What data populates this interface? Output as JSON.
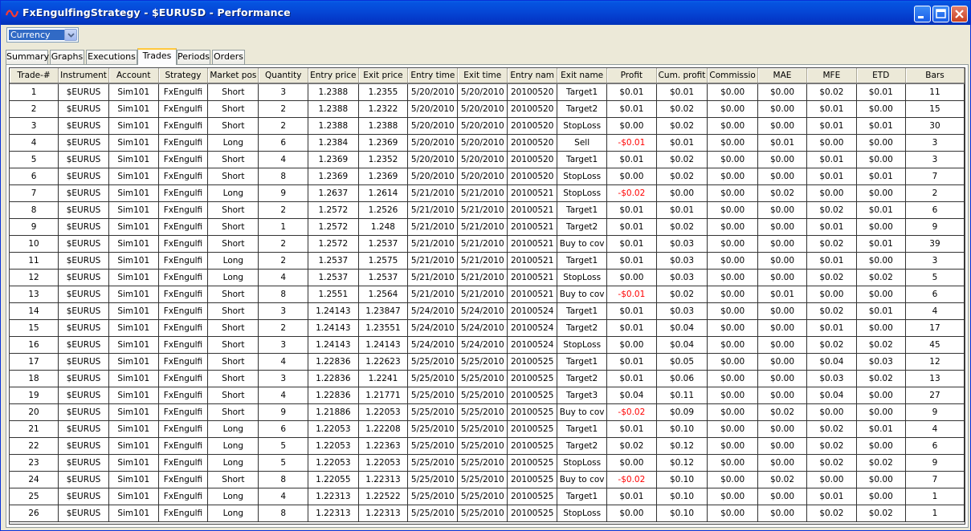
{
  "window": {
    "title": "FxEngulfingStrategy - $EURUSD - Performance"
  },
  "toolbar": {
    "currency_value": "Currency"
  },
  "tabs": [
    {
      "label": "Summary"
    },
    {
      "label": "Graphs"
    },
    {
      "label": "Executions"
    },
    {
      "label": "Trades"
    },
    {
      "label": "Periods"
    },
    {
      "label": "Orders"
    }
  ],
  "active_tab": "Trades",
  "colors": {
    "negative_profit": "#ff0000",
    "selection": "#316ac5"
  },
  "table": {
    "columns": [
      "Trade-#",
      "Instrument",
      "Account",
      "Strategy",
      "Market pos",
      "Quantity",
      "Entry price",
      "Exit price",
      "Entry time",
      "Exit time",
      "Entry nam",
      "Exit name",
      "Profit",
      "Cum. profit",
      "Commissio",
      "MAE",
      "MFE",
      "ETD",
      "Bars"
    ],
    "rows": [
      [
        "1",
        "$EURUS",
        "Sim101",
        "FxEngulfi",
        "Short",
        "3",
        "1.2388",
        "1.2355",
        "5/20/2010",
        "5/20/2010",
        "20100520",
        "Target1",
        "$0.01",
        "$0.01",
        "$0.00",
        "$0.00",
        "$0.02",
        "$0.01",
        "11"
      ],
      [
        "2",
        "$EURUS",
        "Sim101",
        "FxEngulfi",
        "Short",
        "2",
        "1.2388",
        "1.2322",
        "5/20/2010",
        "5/20/2010",
        "20100520",
        "Target2",
        "$0.01",
        "$0.02",
        "$0.00",
        "$0.00",
        "$0.01",
        "$0.00",
        "15"
      ],
      [
        "3",
        "$EURUS",
        "Sim101",
        "FxEngulfi",
        "Short",
        "2",
        "1.2388",
        "1.2388",
        "5/20/2010",
        "5/20/2010",
        "20100520",
        "StopLoss",
        "$0.00",
        "$0.02",
        "$0.00",
        "$0.00",
        "$0.01",
        "$0.01",
        "30"
      ],
      [
        "4",
        "$EURUS",
        "Sim101",
        "FxEngulfi",
        "Long",
        "6",
        "1.2384",
        "1.2369",
        "5/20/2010",
        "5/20/2010",
        "20100520",
        "Sell",
        "-$0.01",
        "$0.01",
        "$0.00",
        "$0.01",
        "$0.00",
        "$0.00",
        "3"
      ],
      [
        "5",
        "$EURUS",
        "Sim101",
        "FxEngulfi",
        "Short",
        "4",
        "1.2369",
        "1.2352",
        "5/20/2010",
        "5/20/2010",
        "20100520",
        "Target1",
        "$0.01",
        "$0.02",
        "$0.00",
        "$0.00",
        "$0.01",
        "$0.00",
        "3"
      ],
      [
        "6",
        "$EURUS",
        "Sim101",
        "FxEngulfi",
        "Short",
        "8",
        "1.2369",
        "1.2369",
        "5/20/2010",
        "5/20/2010",
        "20100520",
        "StopLoss",
        "$0.00",
        "$0.02",
        "$0.00",
        "$0.00",
        "$0.01",
        "$0.01",
        "7"
      ],
      [
        "7",
        "$EURUS",
        "Sim101",
        "FxEngulfi",
        "Long",
        "9",
        "1.2637",
        "1.2614",
        "5/21/2010",
        "5/21/2010",
        "20100521",
        "StopLoss",
        "-$0.02",
        "$0.00",
        "$0.00",
        "$0.02",
        "$0.00",
        "$0.00",
        "2"
      ],
      [
        "8",
        "$EURUS",
        "Sim101",
        "FxEngulfi",
        "Short",
        "2",
        "1.2572",
        "1.2526",
        "5/21/2010",
        "5/21/2010",
        "20100521",
        "Target1",
        "$0.01",
        "$0.01",
        "$0.00",
        "$0.00",
        "$0.02",
        "$0.01",
        "6"
      ],
      [
        "9",
        "$EURUS",
        "Sim101",
        "FxEngulfi",
        "Short",
        "1",
        "1.2572",
        "1.248",
        "5/21/2010",
        "5/21/2010",
        "20100521",
        "Target2",
        "$0.01",
        "$0.02",
        "$0.00",
        "$0.00",
        "$0.01",
        "$0.00",
        "9"
      ],
      [
        "10",
        "$EURUS",
        "Sim101",
        "FxEngulfi",
        "Short",
        "2",
        "1.2572",
        "1.2537",
        "5/21/2010",
        "5/21/2010",
        "20100521",
        "Buy to cov",
        "$0.01",
        "$0.03",
        "$0.00",
        "$0.00",
        "$0.02",
        "$0.01",
        "39"
      ],
      [
        "11",
        "$EURUS",
        "Sim101",
        "FxEngulfi",
        "Long",
        "2",
        "1.2537",
        "1.2575",
        "5/21/2010",
        "5/21/2010",
        "20100521",
        "Target1",
        "$0.01",
        "$0.03",
        "$0.00",
        "$0.00",
        "$0.01",
        "$0.00",
        "3"
      ],
      [
        "12",
        "$EURUS",
        "Sim101",
        "FxEngulfi",
        "Long",
        "4",
        "1.2537",
        "1.2537",
        "5/21/2010",
        "5/21/2010",
        "20100521",
        "StopLoss",
        "$0.00",
        "$0.03",
        "$0.00",
        "$0.00",
        "$0.02",
        "$0.02",
        "5"
      ],
      [
        "13",
        "$EURUS",
        "Sim101",
        "FxEngulfi",
        "Short",
        "8",
        "1.2551",
        "1.2564",
        "5/21/2010",
        "5/21/2010",
        "20100521",
        "Buy to cov",
        "-$0.01",
        "$0.02",
        "$0.00",
        "$0.01",
        "$0.00",
        "$0.00",
        "6"
      ],
      [
        "14",
        "$EURUS",
        "Sim101",
        "FxEngulfi",
        "Short",
        "3",
        "1.24143",
        "1.23847",
        "5/24/2010",
        "5/24/2010",
        "20100524",
        "Target1",
        "$0.01",
        "$0.03",
        "$0.00",
        "$0.00",
        "$0.02",
        "$0.01",
        "4"
      ],
      [
        "15",
        "$EURUS",
        "Sim101",
        "FxEngulfi",
        "Short",
        "2",
        "1.24143",
        "1.23551",
        "5/24/2010",
        "5/24/2010",
        "20100524",
        "Target2",
        "$0.01",
        "$0.04",
        "$0.00",
        "$0.00",
        "$0.01",
        "$0.00",
        "17"
      ],
      [
        "16",
        "$EURUS",
        "Sim101",
        "FxEngulfi",
        "Short",
        "3",
        "1.24143",
        "1.24143",
        "5/24/2010",
        "5/24/2010",
        "20100524",
        "StopLoss",
        "$0.00",
        "$0.04",
        "$0.00",
        "$0.00",
        "$0.02",
        "$0.02",
        "45"
      ],
      [
        "17",
        "$EURUS",
        "Sim101",
        "FxEngulfi",
        "Short",
        "4",
        "1.22836",
        "1.22623",
        "5/25/2010",
        "5/25/2010",
        "20100525",
        "Target1",
        "$0.01",
        "$0.05",
        "$0.00",
        "$0.00",
        "$0.04",
        "$0.03",
        "12"
      ],
      [
        "18",
        "$EURUS",
        "Sim101",
        "FxEngulfi",
        "Short",
        "3",
        "1.22836",
        "1.2241",
        "5/25/2010",
        "5/25/2010",
        "20100525",
        "Target2",
        "$0.01",
        "$0.06",
        "$0.00",
        "$0.00",
        "$0.03",
        "$0.02",
        "13"
      ],
      [
        "19",
        "$EURUS",
        "Sim101",
        "FxEngulfi",
        "Short",
        "4",
        "1.22836",
        "1.21771",
        "5/25/2010",
        "5/25/2010",
        "20100525",
        "Target3",
        "$0.04",
        "$0.11",
        "$0.00",
        "$0.00",
        "$0.04",
        "$0.00",
        "27"
      ],
      [
        "20",
        "$EURUS",
        "Sim101",
        "FxEngulfi",
        "Short",
        "9",
        "1.21886",
        "1.22053",
        "5/25/2010",
        "5/25/2010",
        "20100525",
        "Buy to cov",
        "-$0.02",
        "$0.09",
        "$0.00",
        "$0.02",
        "$0.00",
        "$0.00",
        "9"
      ],
      [
        "21",
        "$EURUS",
        "Sim101",
        "FxEngulfi",
        "Long",
        "6",
        "1.22053",
        "1.22208",
        "5/25/2010",
        "5/25/2010",
        "20100525",
        "Target1",
        "$0.01",
        "$0.10",
        "$0.00",
        "$0.00",
        "$0.02",
        "$0.01",
        "4"
      ],
      [
        "22",
        "$EURUS",
        "Sim101",
        "FxEngulfi",
        "Long",
        "5",
        "1.22053",
        "1.22363",
        "5/25/2010",
        "5/25/2010",
        "20100525",
        "Target2",
        "$0.02",
        "$0.12",
        "$0.00",
        "$0.00",
        "$0.02",
        "$0.00",
        "6"
      ],
      [
        "23",
        "$EURUS",
        "Sim101",
        "FxEngulfi",
        "Long",
        "5",
        "1.22053",
        "1.22053",
        "5/25/2010",
        "5/25/2010",
        "20100525",
        "StopLoss",
        "$0.00",
        "$0.12",
        "$0.00",
        "$0.00",
        "$0.02",
        "$0.02",
        "9"
      ],
      [
        "24",
        "$EURUS",
        "Sim101",
        "FxEngulfi",
        "Short",
        "8",
        "1.22055",
        "1.22313",
        "5/25/2010",
        "5/25/2010",
        "20100525",
        "Buy to cov",
        "-$0.02",
        "$0.10",
        "$0.00",
        "$0.02",
        "$0.00",
        "$0.00",
        "7"
      ],
      [
        "25",
        "$EURUS",
        "Sim101",
        "FxEngulfi",
        "Long",
        "4",
        "1.22313",
        "1.22522",
        "5/25/2010",
        "5/25/2010",
        "20100525",
        "Target1",
        "$0.01",
        "$0.10",
        "$0.00",
        "$0.00",
        "$0.01",
        "$0.00",
        "1"
      ],
      [
        "26",
        "$EURUS",
        "Sim101",
        "FxEngulfi",
        "Long",
        "8",
        "1.22313",
        "1.22313",
        "5/25/2010",
        "5/25/2010",
        "20100525",
        "StopLoss",
        "$0.00",
        "$0.10",
        "$0.00",
        "$0.00",
        "$0.02",
        "$0.02",
        "1"
      ]
    ]
  }
}
